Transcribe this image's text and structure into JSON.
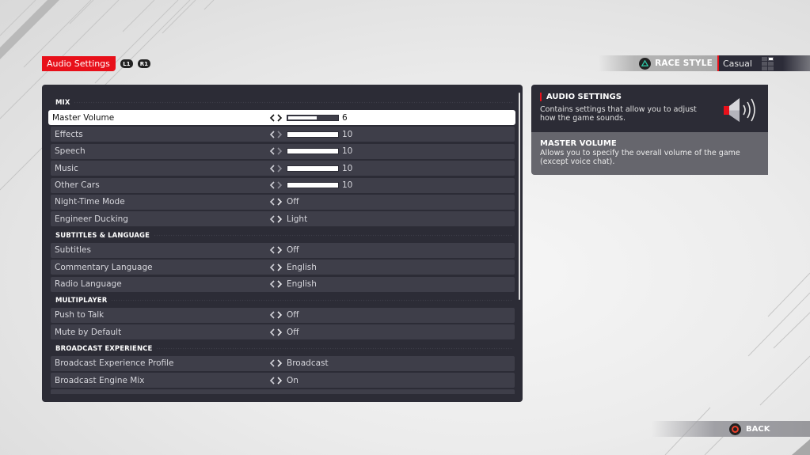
{
  "header": {
    "active_tab": "Audio Settings",
    "prev_tab_button": "L1",
    "next_tab_button": "R1"
  },
  "race_style": {
    "label": "RACE STYLE",
    "value": "Casual",
    "button_icon": "triangle-icon"
  },
  "settings": {
    "sections": [
      {
        "title": "MIX",
        "rows": [
          {
            "label": "Master Volume",
            "type": "slider",
            "value": "6",
            "fraction": 0.6,
            "selected": true
          },
          {
            "label": "Effects",
            "type": "slider",
            "value": "10",
            "fraction": 1.0
          },
          {
            "label": "Speech",
            "type": "slider",
            "value": "10",
            "fraction": 1.0
          },
          {
            "label": "Music",
            "type": "slider",
            "value": "10",
            "fraction": 1.0
          },
          {
            "label": "Other Cars",
            "type": "slider",
            "value": "10",
            "fraction": 1.0
          },
          {
            "label": "Night-Time Mode",
            "type": "option",
            "value": "Off"
          },
          {
            "label": "Engineer Ducking",
            "type": "option",
            "value": "Light"
          }
        ]
      },
      {
        "title": "SUBTITLES & LANGUAGE",
        "rows": [
          {
            "label": "Subtitles",
            "type": "option",
            "value": "Off"
          },
          {
            "label": "Commentary Language",
            "type": "option",
            "value": "English"
          },
          {
            "label": "Radio Language",
            "type": "option",
            "value": "English"
          }
        ]
      },
      {
        "title": "MULTIPLAYER",
        "rows": [
          {
            "label": "Push to Talk",
            "type": "option",
            "value": "Off"
          },
          {
            "label": "Mute by Default",
            "type": "option",
            "value": "Off"
          }
        ]
      },
      {
        "title": "BROADCAST EXPERIENCE",
        "rows": [
          {
            "label": "Broadcast Experience Profile",
            "type": "option",
            "value": "Broadcast"
          },
          {
            "label": "Broadcast Engine Mix",
            "type": "option",
            "value": "On"
          }
        ]
      }
    ]
  },
  "info": {
    "title": "AUDIO SETTINGS",
    "description": "Contains settings that allow you to adjust how the game sounds.",
    "icon": "speaker-icon",
    "sub_title": "MASTER VOLUME",
    "sub_description": "Allows you to specify the overall volume of the game (except voice chat)."
  },
  "footer": {
    "back_label": "BACK",
    "back_icon": "circle-icon"
  },
  "colors": {
    "accent": "#e8101a",
    "panel": "#2c2c36",
    "row": "#3e3e49",
    "selected_row": "#ffffff"
  }
}
